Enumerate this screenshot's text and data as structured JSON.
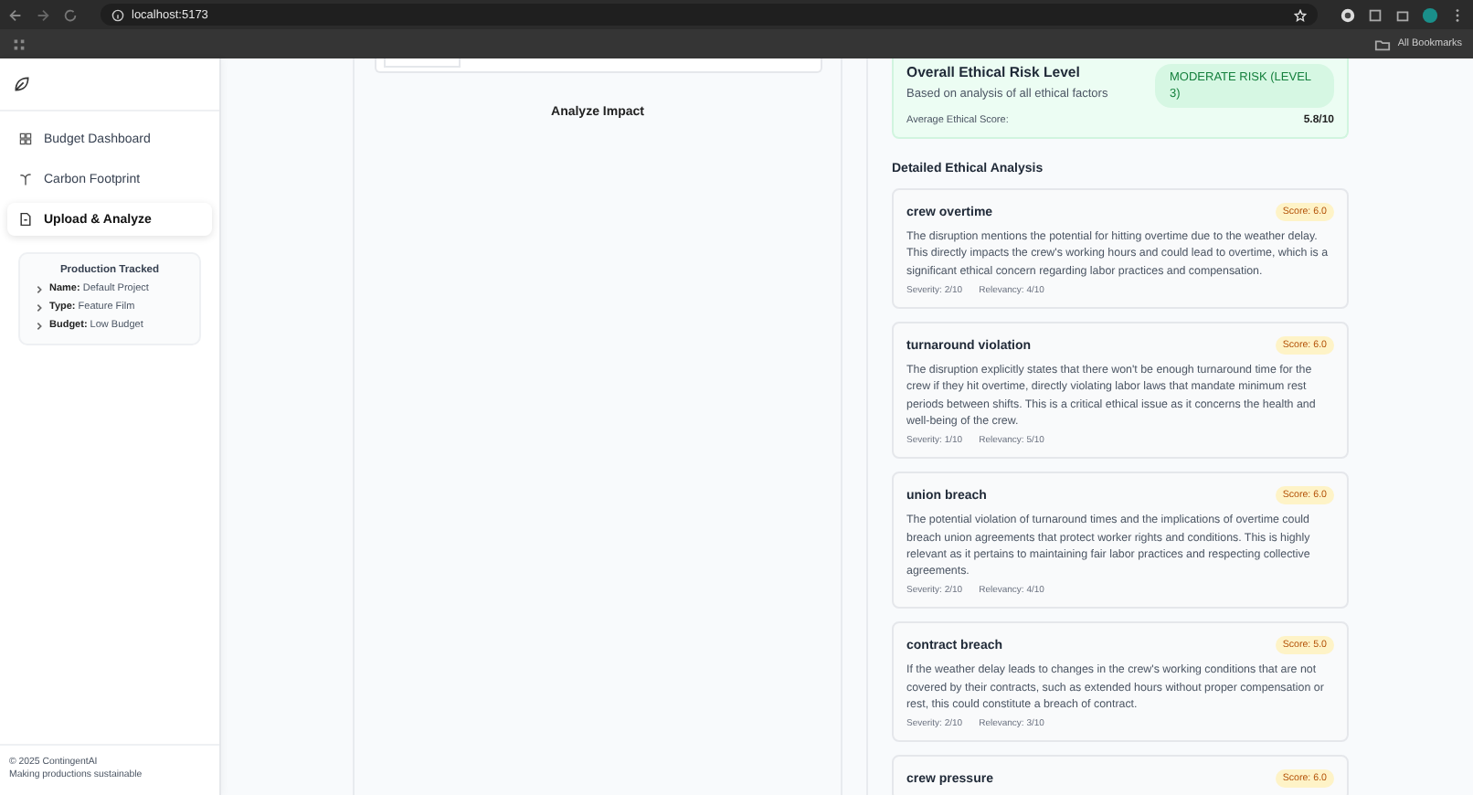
{
  "browser": {
    "url": "localhost:5173",
    "bookmarks_label": "All Bookmarks"
  },
  "sidebar": {
    "items": [
      {
        "label": "Budget Dashboard",
        "kind": "grid",
        "selected": false
      },
      {
        "label": "Carbon Footprint",
        "kind": "sprout",
        "selected": false
      },
      {
        "label": "Upload & Analyze",
        "kind": "file",
        "selected": true
      }
    ],
    "production": {
      "title": "Production Tracked",
      "fields": [
        {
          "text": "**Name:** Default Project"
        },
        {
          "text": "**Type:** Feature Film"
        },
        {
          "text": "**Budget:** Low Budget"
        }
      ]
    },
    "footer": [
      "© 2025 ContingentAI",
      "Making productions sustainable"
    ]
  },
  "center": {
    "analyze_label": "Analyze Impact"
  },
  "overall": {
    "title": "Overall Ethical Risk Level",
    "subtitle": "Based on analysis of all ethical factors",
    "risk_badge": "MODERATE RISK (LEVEL 3)",
    "average_label": "Average Ethical Score:",
    "average_value": "5.8/10"
  },
  "analysis": {
    "title": "Detailed Ethical Analysis",
    "items": [
      {
        "title": "crew overtime",
        "score": "Score: 6.0",
        "description": "The disruption mentions the potential for hitting overtime due to the weather delay. This directly impacts the crew's working hours and could lead to overtime, which is a significant ethical concern regarding labor practices and compensation.",
        "severity": "Severity: 2/10",
        "relevancy": "Relevancy: 4/10"
      },
      {
        "title": "turnaround violation",
        "score": "Score: 6.0",
        "description": "The disruption explicitly states that there won't be enough turnaround time for the crew if they hit overtime, directly violating labor laws that mandate minimum rest periods between shifts. This is a critical ethical issue as it concerns the health and well-being of the crew.",
        "severity": "Severity: 1/10",
        "relevancy": "Relevancy: 5/10"
      },
      {
        "title": "union breach",
        "score": "Score: 6.0",
        "description": "The potential violation of turnaround times and the implications of overtime could breach union agreements that protect worker rights and conditions. This is highly relevant as it pertains to maintaining fair labor practices and respecting collective agreements.",
        "severity": "Severity: 2/10",
        "relevancy": "Relevancy: 4/10"
      },
      {
        "title": "contract breach",
        "score": "Score: 5.0",
        "description": "If the weather delay leads to changes in the crew's working conditions that are not covered by their contracts, such as extended hours without proper compensation or rest, this could constitute a breach of contract.",
        "severity": "Severity: 2/10",
        "relevancy": "Relevancy: 3/10"
      },
      {
        "title": "crew pressure",
        "score": "Score: 6.0"
      }
    ]
  }
}
